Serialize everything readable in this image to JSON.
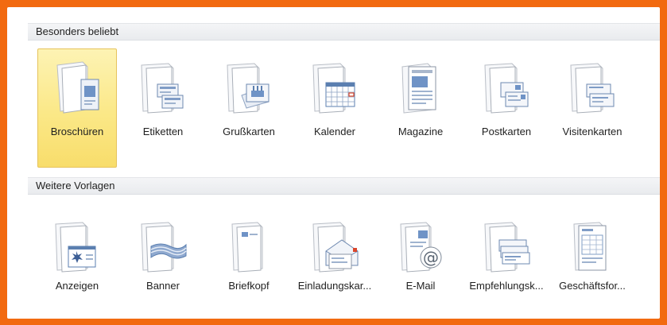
{
  "sections": [
    {
      "title": "Besonders beliebt",
      "items": [
        {
          "label": "Broschüren",
          "icon": "brochure-icon",
          "selected": true
        },
        {
          "label": "Etiketten",
          "icon": "label-icon"
        },
        {
          "label": "Grußkarten",
          "icon": "greeting-card-icon"
        },
        {
          "label": "Kalender",
          "icon": "calendar-icon"
        },
        {
          "label": "Magazine",
          "icon": "magazine-icon"
        },
        {
          "label": "Postkarten",
          "icon": "postcard-icon"
        },
        {
          "label": "Visitenkarten",
          "icon": "business-card-icon"
        }
      ]
    },
    {
      "title": "Weitere Vorlagen",
      "items": [
        {
          "label": "Anzeigen",
          "icon": "advertisement-icon"
        },
        {
          "label": "Banner",
          "icon": "banner-icon"
        },
        {
          "label": "Briefkopf",
          "icon": "letterhead-icon"
        },
        {
          "label": "Einladungskar...",
          "icon": "invitation-card-icon"
        },
        {
          "label": "E-Mail",
          "icon": "email-icon"
        },
        {
          "label": "Empfehlungsk...",
          "icon": "recommendation-card-icon"
        },
        {
          "label": "Geschäftsfor...",
          "icon": "business-form-icon"
        }
      ]
    }
  ],
  "colors": {
    "frame_border": "#f26a10",
    "selected_fill": "#fbe887",
    "selected_border": "#e6c35c",
    "icon_blue": "#5b7fb0",
    "icon_red": "#d9452b"
  }
}
